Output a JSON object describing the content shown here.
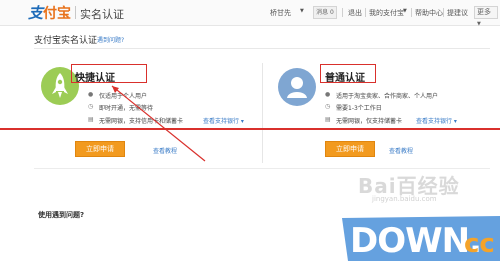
{
  "topbar": {
    "logo": "支付宝",
    "section": "实名认证",
    "user": "桥甘先",
    "message_btn": "消息 0",
    "logout": "退出",
    "my_alipay": "我的支付宝",
    "help_center": "帮助中心",
    "tip": "提建议",
    "more": "更多"
  },
  "page": {
    "title": "支付宝实名认证",
    "help_link": "遇到问题?"
  },
  "quick_auth": {
    "title": "快捷认证",
    "features": [
      "仅适用于个人用户",
      "即时开通，无需等待",
      "无需网银，支持信用卡和储蓄卡"
    ],
    "bank_link": "查看支持银行",
    "apply": "立即申请",
    "tutorial": "查看教程"
  },
  "normal_auth": {
    "title": "普通认证",
    "features": [
      "适用于淘宝卖家、合作商家、个人用户",
      "需要1-3个工作日",
      "无需网银，仅支持储蓄卡"
    ],
    "bank_link": "查看支持银行",
    "apply": "立即申请",
    "tutorial": "查看教程"
  },
  "faq": {
    "title": "使用遇到问题?"
  },
  "watermarks": {
    "baidu": "Bai百经验",
    "jingyan": "jingyan.baidu.com",
    "down_brand": "DOWN.cc"
  },
  "colors": {
    "accent_orange": "#f29a1f",
    "link_blue": "#3a7cc7",
    "highlight_red": "#d9302c",
    "quick_icon_green": "#9ccc55",
    "normal_icon_blue": "#7fa6d2"
  }
}
